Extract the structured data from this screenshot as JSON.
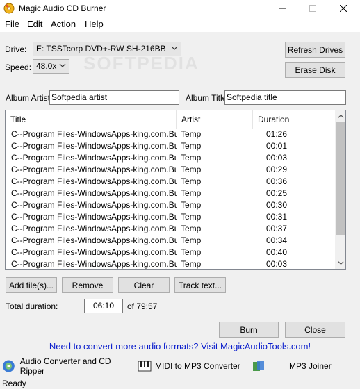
{
  "window": {
    "title": "Magic Audio CD Burner"
  },
  "menu": [
    "File",
    "Edit",
    "Action",
    "Help"
  ],
  "drive": {
    "label": "Drive:",
    "value": "E: TSSTcorp DVD+-RW SH-216BB"
  },
  "speed": {
    "label": "Speed:",
    "value": "48.0x"
  },
  "buttons": {
    "refresh_drives": "Refresh Drives",
    "erase_disk": "Erase Disk",
    "add_files": "Add file(s)...",
    "remove": "Remove",
    "clear": "Clear",
    "track_text": "Track text...",
    "burn": "Burn",
    "close": "Close"
  },
  "album": {
    "artist_label": "Album Artist:",
    "artist_value": "Softpedia artist",
    "title_label": "Album Title:",
    "title_value": "Softpedia title"
  },
  "tracklist": {
    "columns": [
      "Title",
      "Artist",
      "Duration"
    ],
    "rows": [
      {
        "title": "C--Program Files-WindowsApps-king.com.Bub...",
        "artist": "Temp",
        "duration": "01:26"
      },
      {
        "title": "C--Program Files-WindowsApps-king.com.Bub...",
        "artist": "Temp",
        "duration": "00:01"
      },
      {
        "title": "C--Program Files-WindowsApps-king.com.Bub...",
        "artist": "Temp",
        "duration": "00:03"
      },
      {
        "title": "C--Program Files-WindowsApps-king.com.Bub...",
        "artist": "Temp",
        "duration": "00:29"
      },
      {
        "title": "C--Program Files-WindowsApps-king.com.Bub...",
        "artist": "Temp",
        "duration": "00:36"
      },
      {
        "title": "C--Program Files-WindowsApps-king.com.Bub...",
        "artist": "Temp",
        "duration": "00:25"
      },
      {
        "title": "C--Program Files-WindowsApps-king.com.Bub...",
        "artist": "Temp",
        "duration": "00:30"
      },
      {
        "title": "C--Program Files-WindowsApps-king.com.Bub...",
        "artist": "Temp",
        "duration": "00:31"
      },
      {
        "title": "C--Program Files-WindowsApps-king.com.Bub...",
        "artist": "Temp",
        "duration": "00:37"
      },
      {
        "title": "C--Program Files-WindowsApps-king.com.Bub...",
        "artist": "Temp",
        "duration": "00:34"
      },
      {
        "title": "C--Program Files-WindowsApps-king.com.Bub...",
        "artist": "Temp",
        "duration": "00:40"
      },
      {
        "title": "C--Program Files-WindowsApps-king.com.Bub...",
        "artist": "Temp",
        "duration": "00:03"
      }
    ]
  },
  "total": {
    "label": "Total duration:",
    "value": "06:10",
    "of": "of 79:57"
  },
  "promo": "Need to convert more audio formats? Visit MagicAudioTools.com!",
  "tools": {
    "converter": "Audio Converter and CD Ripper",
    "midi": "MIDI to MP3 Converter",
    "joiner": "MP3  Joiner"
  },
  "status": "Ready",
  "watermark": "SOFTPEDIA",
  "colors": {
    "link": "#0b1ecc",
    "window_bg": "#f0f0f0"
  }
}
